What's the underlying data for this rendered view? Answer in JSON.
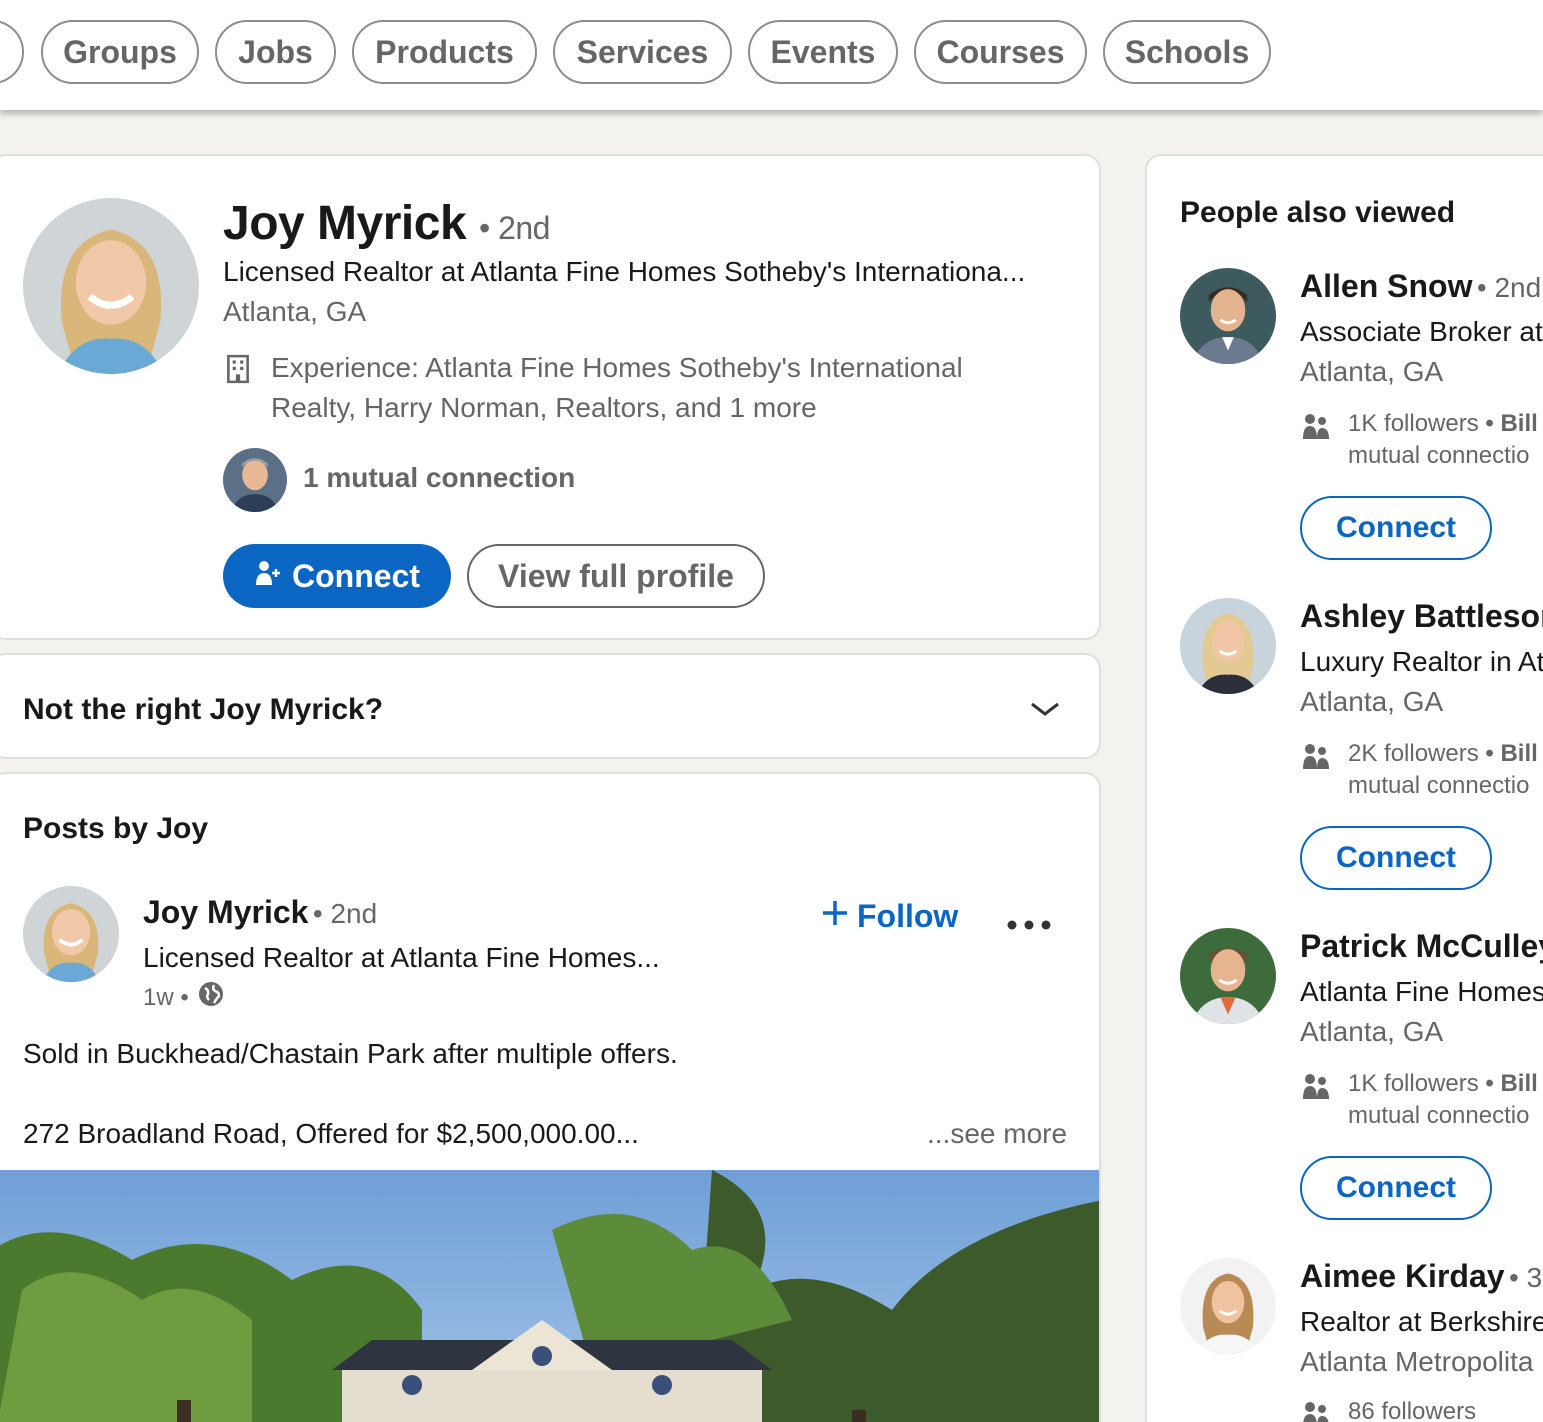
{
  "filters": [
    {
      "label": ""
    },
    {
      "label": "Groups"
    },
    {
      "label": "Jobs"
    },
    {
      "label": "Products"
    },
    {
      "label": "Services"
    },
    {
      "label": "Events"
    },
    {
      "label": "Courses"
    },
    {
      "label": "Schools"
    }
  ],
  "profile": {
    "name": "Joy Myrick",
    "degree": "• 2nd",
    "headline": "Licensed Realtor at Atlanta Fine Homes Sotheby's Internationa...",
    "location": "Atlanta, GA",
    "experience_line1": "Experience: Atlanta Fine Homes Sotheby's International",
    "experience_line2": "Realty, Harry Norman, Realtors, and 1 more",
    "mutual": "1 mutual connection",
    "connect_label": "Connect",
    "view_profile_label": "View full profile"
  },
  "not_right": {
    "label": "Not the right Joy Myrick?"
  },
  "posts": {
    "heading": "Posts by Joy",
    "post": {
      "author": "Joy Myrick",
      "degree": "• 2nd",
      "headline": "Licensed Realtor at Atlanta Fine Homes...",
      "time": "1w •",
      "follow_label": "Follow",
      "text_line1": "Sold in Buckhead/Chastain Park after multiple offers.",
      "text_line2": "272 Broadland Road, Offered for $2,500,000.00...",
      "see_more": "...see more"
    }
  },
  "people_also_viewed": {
    "heading": "People also viewed",
    "people": [
      {
        "name": "Allen Snow",
        "degree": "• 2nd",
        "headline": "Associate Broker at",
        "location": "Atlanta, GA",
        "followers": "1K followers",
        "mutual_bold": "• Bill",
        "mutual_rest": "mutual connectio",
        "connect": "Connect"
      },
      {
        "name": "Ashley Battleson",
        "degree": "",
        "headline": "Luxury Realtor in At",
        "location": "Atlanta, GA",
        "followers": "2K followers",
        "mutual_bold": "• Bill",
        "mutual_rest": "mutual connectio",
        "connect": "Connect"
      },
      {
        "name": "Patrick McCulley",
        "degree": "",
        "headline": "Atlanta Fine Homes",
        "location": "Atlanta, GA",
        "followers": "1K followers",
        "mutual_bold": "• Bill",
        "mutual_rest": "mutual connectio",
        "connect": "Connect"
      },
      {
        "name": "Aimee Kirday",
        "degree": "• 3",
        "headline": "Realtor at Berkshire",
        "location": "Atlanta Metropolita",
        "followers": "86 followers",
        "mutual_bold": "",
        "mutual_rest": "",
        "connect": ""
      }
    ]
  },
  "colors": {
    "brand_blue": "#0a66c2",
    "page_bg": "#f4f2ee",
    "muted_text": "#666666"
  }
}
